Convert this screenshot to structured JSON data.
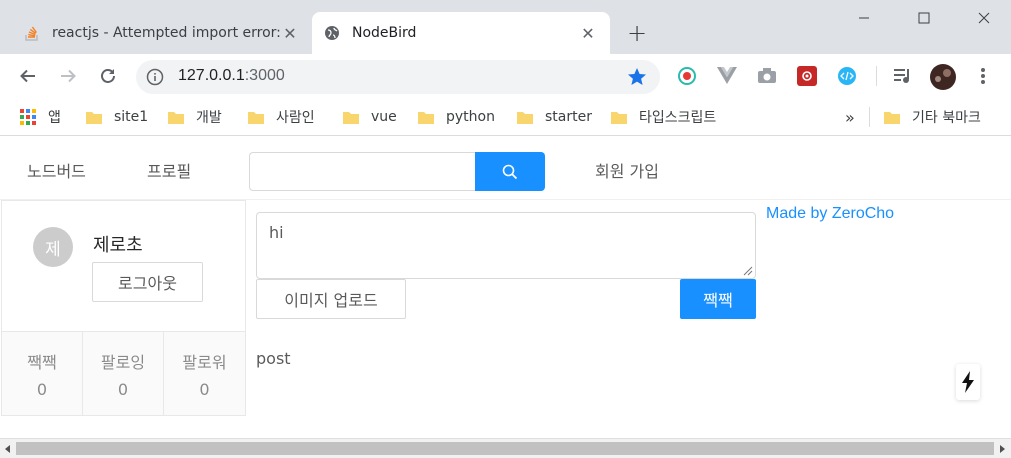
{
  "tabs": [
    {
      "title": "reactjs - Attempted import error:",
      "active": false,
      "icon": "stackoverflow-icon"
    },
    {
      "title": "NodeBird",
      "active": true,
      "icon": "globe-icon"
    }
  ],
  "tab_close_symbol": "✕",
  "new_tab_symbol": "+",
  "address_bar": {
    "host": "127.0.0.1",
    "port": ":3000"
  },
  "extensions": [
    "recording-ext-icon",
    "vue-devtools-icon",
    "camera-ext-icon",
    "redux-devtools-icon",
    "code-ext-icon"
  ],
  "bookmarks": {
    "apps_label": "앱",
    "items": [
      "site1",
      "개발",
      "사람인",
      "vue",
      "python",
      "starter",
      "타입스크립트"
    ],
    "overflow": "»",
    "other_label": "기타 북마크"
  },
  "nav": {
    "home": "노드버드",
    "profile": "프로필",
    "search_placeholder": "",
    "signup": "회원 가입"
  },
  "user_card": {
    "avatar_initial": "제",
    "nickname": "제로초",
    "logout_label": "로그아웃",
    "stats": [
      {
        "label": "짹짹",
        "value": "0"
      },
      {
        "label": "팔로잉",
        "value": "0"
      },
      {
        "label": "팔로워",
        "value": "0"
      }
    ]
  },
  "post_form": {
    "text": "hi",
    "upload_label": "이미지 업로드",
    "submit_label": "짹짹"
  },
  "post_text": "post",
  "credit": "Made by ZeroCho",
  "colors": {
    "primary": "#1890ff",
    "tabstrip": "#dee1e6"
  }
}
